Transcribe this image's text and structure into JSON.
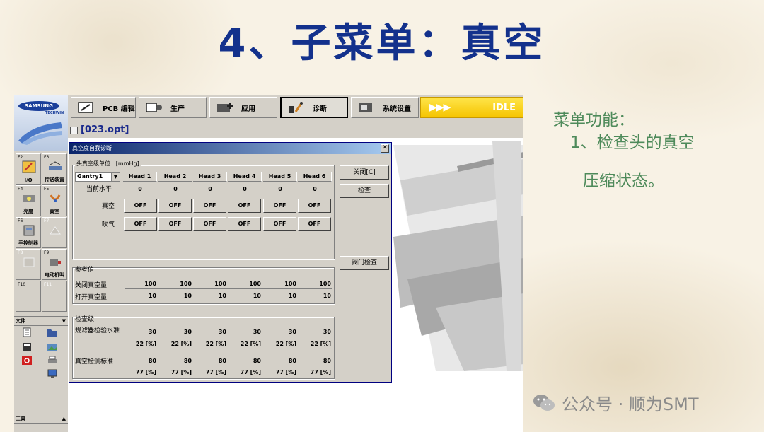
{
  "slide": {
    "title": "4、子菜单：真空",
    "bullet_heading": "菜单功能：",
    "bullet_1": "1、检查头的真空",
    "bullet_1_cont": "压缩状态。",
    "watermark": "公众号 · 顺为SMT"
  },
  "logo": {
    "brand": "SAMSUNG",
    "sub": "TECHWIN"
  },
  "toolbar": {
    "items": [
      {
        "label": "PCB 编辑",
        "icon": "pcb-edit-icon"
      },
      {
        "label": "生产",
        "icon": "production-icon"
      },
      {
        "label": "应用",
        "icon": "application-icon"
      },
      {
        "label": "诊断",
        "icon": "diagnosis-icon",
        "active": true
      },
      {
        "label": "系统设置",
        "icon": "system-settings-icon"
      }
    ],
    "status_arrows": "▶▶▶",
    "status": "IDLE",
    "status_color": "#f5c400"
  },
  "file": {
    "name": "[023.opt]"
  },
  "sidebar": {
    "fkeys": [
      {
        "key": "F2",
        "label": "I/O"
      },
      {
        "key": "F3",
        "label": "传送装置"
      },
      {
        "key": "F4",
        "label": "亮度"
      },
      {
        "key": "F5",
        "label": "真空"
      },
      {
        "key": "F6",
        "label": "手控制器"
      },
      {
        "key": "F7",
        "label": ""
      },
      {
        "key": "F8",
        "label": ""
      },
      {
        "key": "F9",
        "label": "电动机叫"
      },
      {
        "key": "F10",
        "label": ""
      },
      {
        "key": "F11",
        "label": ""
      }
    ],
    "file_panel": "文件",
    "tools_panel": "工具"
  },
  "dialog": {
    "title": "真空度自我诊断",
    "close_glyph": "✕",
    "unit_label": "头真空级单位 : [mmHg]",
    "gantry": "Gantry1",
    "heads": [
      "Head 1",
      "Head 2",
      "Head 3",
      "Head 4",
      "Head 5",
      "Head 6"
    ],
    "current_level_label": "当前水平",
    "current_levels": [
      "0",
      "0",
      "0",
      "0",
      "0",
      "0"
    ],
    "vacuum_label": "真空",
    "vacuum_states": [
      "OFF",
      "OFF",
      "OFF",
      "OFF",
      "OFF",
      "OFF"
    ],
    "blow_label": "吹气",
    "blow_states": [
      "OFF",
      "OFF",
      "OFF",
      "OFF",
      "OFF",
      "OFF"
    ],
    "buttons": {
      "close": "关闭[C]",
      "check": "检查",
      "valve_check": "阀门检查"
    },
    "reference_group": "参考值",
    "close_vacuum_label": "关闭真空量",
    "close_vacuum": [
      "100",
      "100",
      "100",
      "100",
      "100",
      "100"
    ],
    "open_vacuum_label": "打开真空量",
    "open_vacuum": [
      "10",
      "10",
      "10",
      "10",
      "10",
      "10"
    ],
    "check_group": "检查级",
    "filter_check_label": "规滤器检验水准",
    "filter_check": [
      "30",
      "30",
      "30",
      "30",
      "30",
      "30"
    ],
    "filter_check_pct": [
      "22 [%]",
      "22 [%]",
      "22 [%]",
      "22 [%]",
      "22 [%]",
      "22 [%]"
    ],
    "vacuum_check_label": "真空检测标准",
    "vacuum_check": [
      "80",
      "80",
      "80",
      "80",
      "80",
      "80"
    ],
    "vacuum_check_pct": [
      "77 [%]",
      "77 [%]",
      "77 [%]",
      "77 [%]",
      "77 [%]",
      "77 [%]"
    ]
  }
}
